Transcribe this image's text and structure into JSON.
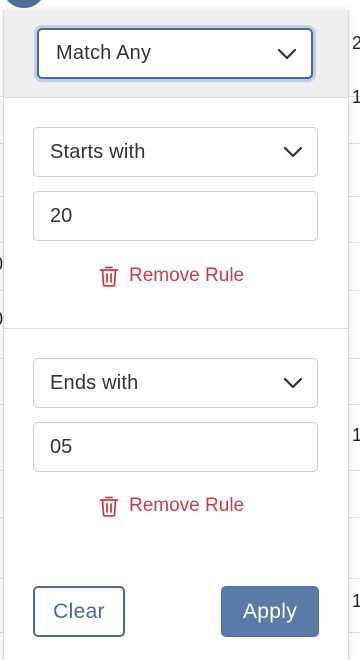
{
  "background_table": {
    "cells": [
      "2",
      "1",
      "0",
      "0",
      "1",
      "1"
    ]
  },
  "filter": {
    "operator_select": {
      "value": "Match Any"
    },
    "rules": [
      {
        "condition": "Starts with",
        "value": "20",
        "remove_label": "Remove Rule"
      },
      {
        "condition": "Ends with",
        "value": "05",
        "remove_label": "Remove Rule"
      }
    ],
    "footer": {
      "clear_label": "Clear",
      "apply_label": "Apply"
    }
  },
  "icons": {
    "dropdown": "chevron-down-icon",
    "remove": "trash-icon"
  },
  "colors": {
    "primary": "#5a7aa8",
    "danger": "#d23a4a",
    "header_bg": "#efefef"
  }
}
